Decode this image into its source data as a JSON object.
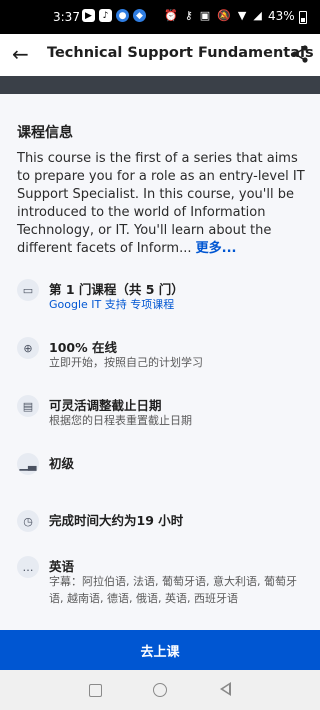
{
  "status_bar": {
    "time": "3:37",
    "battery": "43%"
  },
  "app_bar": {
    "title": "Technical Support Fundamentals"
  },
  "course_info": {
    "heading": "课程信息",
    "description": "This course is the first of a series that aims to prepare you for a role as an entry-level IT Support Specialist. In this course, you'll be introduced to the world of Information Technology, or IT. You'll learn about the different facets of Inform...",
    "more_label": "更多..."
  },
  "info_items": [
    {
      "icon": "stack-icon",
      "main": "第 1 门课程（共 5 门）",
      "sub": "Google IT 支持 专项课程"
    },
    {
      "icon": "globe-icon",
      "main": "100% 在线",
      "sub": "立即开始，按照自己的计划学习"
    },
    {
      "icon": "calendar-icon",
      "main": "可灵活调整截止日期",
      "sub": "根据您的日程表重置截止日期"
    },
    {
      "icon": "level-bars-icon",
      "main": "初级",
      "sub": ""
    },
    {
      "icon": "clock-icon",
      "main": "完成时间大约为19 小时",
      "sub": ""
    },
    {
      "icon": "chat-icon",
      "main": "英语",
      "sub": "字幕：阿拉伯语, 法语, 葡萄牙语, 意大利语, 葡萄牙语, 越南语, 德语, 俄语, 英语, 西班牙语"
    }
  ],
  "cta": {
    "label": "去上课"
  },
  "colors": {
    "accent": "#0056d2",
    "band": "#3a4048"
  }
}
